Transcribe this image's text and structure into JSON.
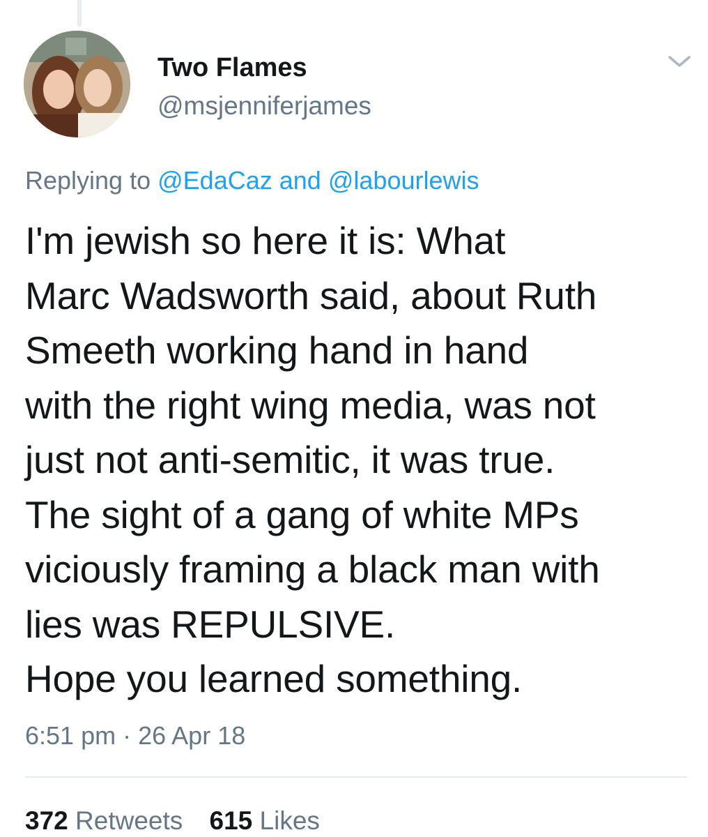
{
  "author": {
    "display_name": "Two Flames",
    "handle": "@msjenniferjames",
    "avatar_icon": "profile-photo-two-women"
  },
  "reply": {
    "prefix": "Replying to",
    "mention_1": "@EdaCaz",
    "joiner": "and",
    "mention_2": "@labourlewis"
  },
  "tweet": {
    "lines": [
      "I'm jewish so here it is: What",
      "Marc Wadsworth said, about Ruth",
      "Smeeth working hand in hand",
      "with the right wing media, was not",
      "just not anti-semitic, it was true.",
      "The sight of a gang of white MPs",
      "viciously framing a black man with",
      "lies was REPULSIVE.",
      "Hope you learned something."
    ],
    "time": "6:51 pm",
    "separator": "·",
    "date": "26 Apr 18"
  },
  "stats": {
    "retweets_count": "372",
    "retweets_label": "Retweets",
    "likes_count": "615",
    "likes_label": "Likes"
  },
  "colors": {
    "link": "#1da1f2",
    "secondary_text": "#657786",
    "primary_text": "#14171a",
    "divider": "#e6ecf0"
  },
  "icons": {
    "menu": "chevron-down-icon"
  }
}
